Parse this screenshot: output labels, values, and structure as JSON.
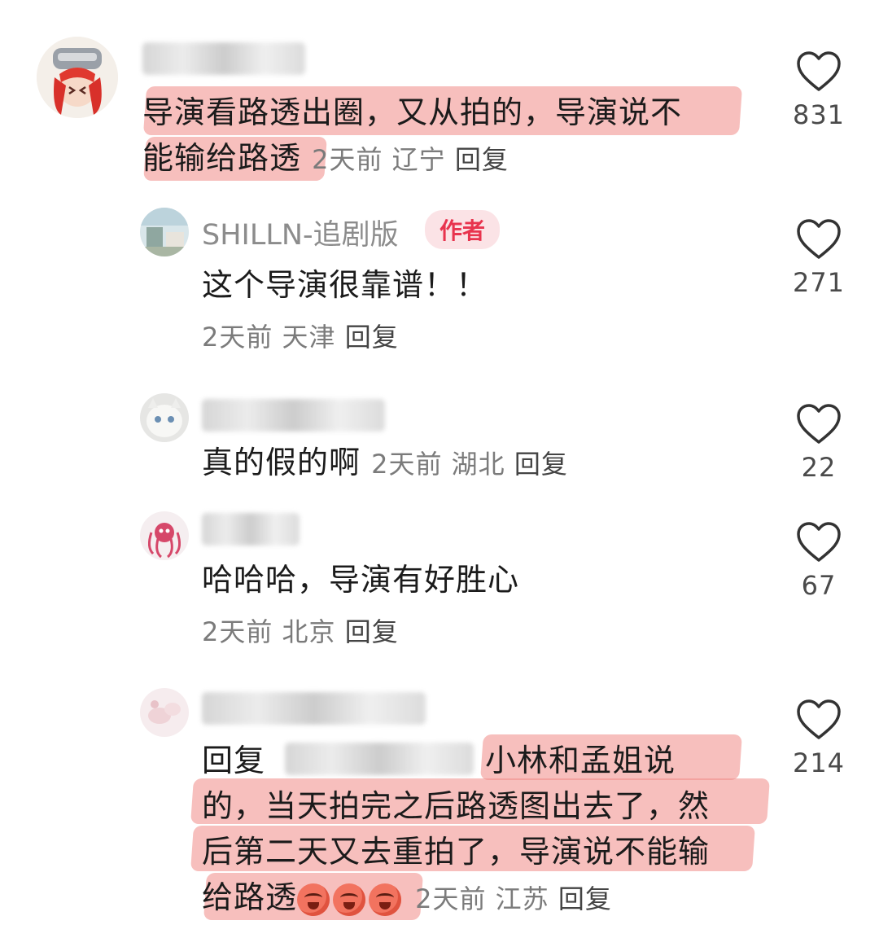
{
  "comments": [
    {
      "text": "导演看路透出圈，又从拍的，导演说不能输给路透",
      "line1": "导演看路透出圈，又从拍的，导演说不",
      "line2": "能输给路透",
      "time": "2天前",
      "location": "辽宁",
      "reply": "回复",
      "likes": "831"
    },
    {
      "author": "SHILLN-追剧版",
      "badge": "作者",
      "text": "这个导演很靠谱！！",
      "time": "2天前",
      "location": "天津",
      "reply": "回复",
      "likes": "271"
    },
    {
      "text": "真的假的啊",
      "time": "2天前",
      "location": "湖北",
      "reply": "回复",
      "likes": "22"
    },
    {
      "text": "哈哈哈，导演有好胜心",
      "time": "2天前",
      "location": "北京",
      "reply": "回复",
      "likes": "67"
    },
    {
      "reply_prefix": "回复",
      "line1": "小林和孟姐说",
      "line2": "的，当天拍完之后路透图出去了，然",
      "line3": "后第二天又去重拍了，导演说不能输",
      "line4": "给路透",
      "emoji_icons": [
        "angry-emoji-icon",
        "angry-emoji-icon",
        "angry-emoji-icon"
      ],
      "time": "2天前",
      "location": "江苏",
      "reply": "回复",
      "likes": "214"
    }
  ],
  "colors": {
    "highlight": "#f08a86",
    "badge_text": "#e8344e",
    "badge_bg": "#fbe3e6",
    "meta": "#7b7b7b"
  }
}
